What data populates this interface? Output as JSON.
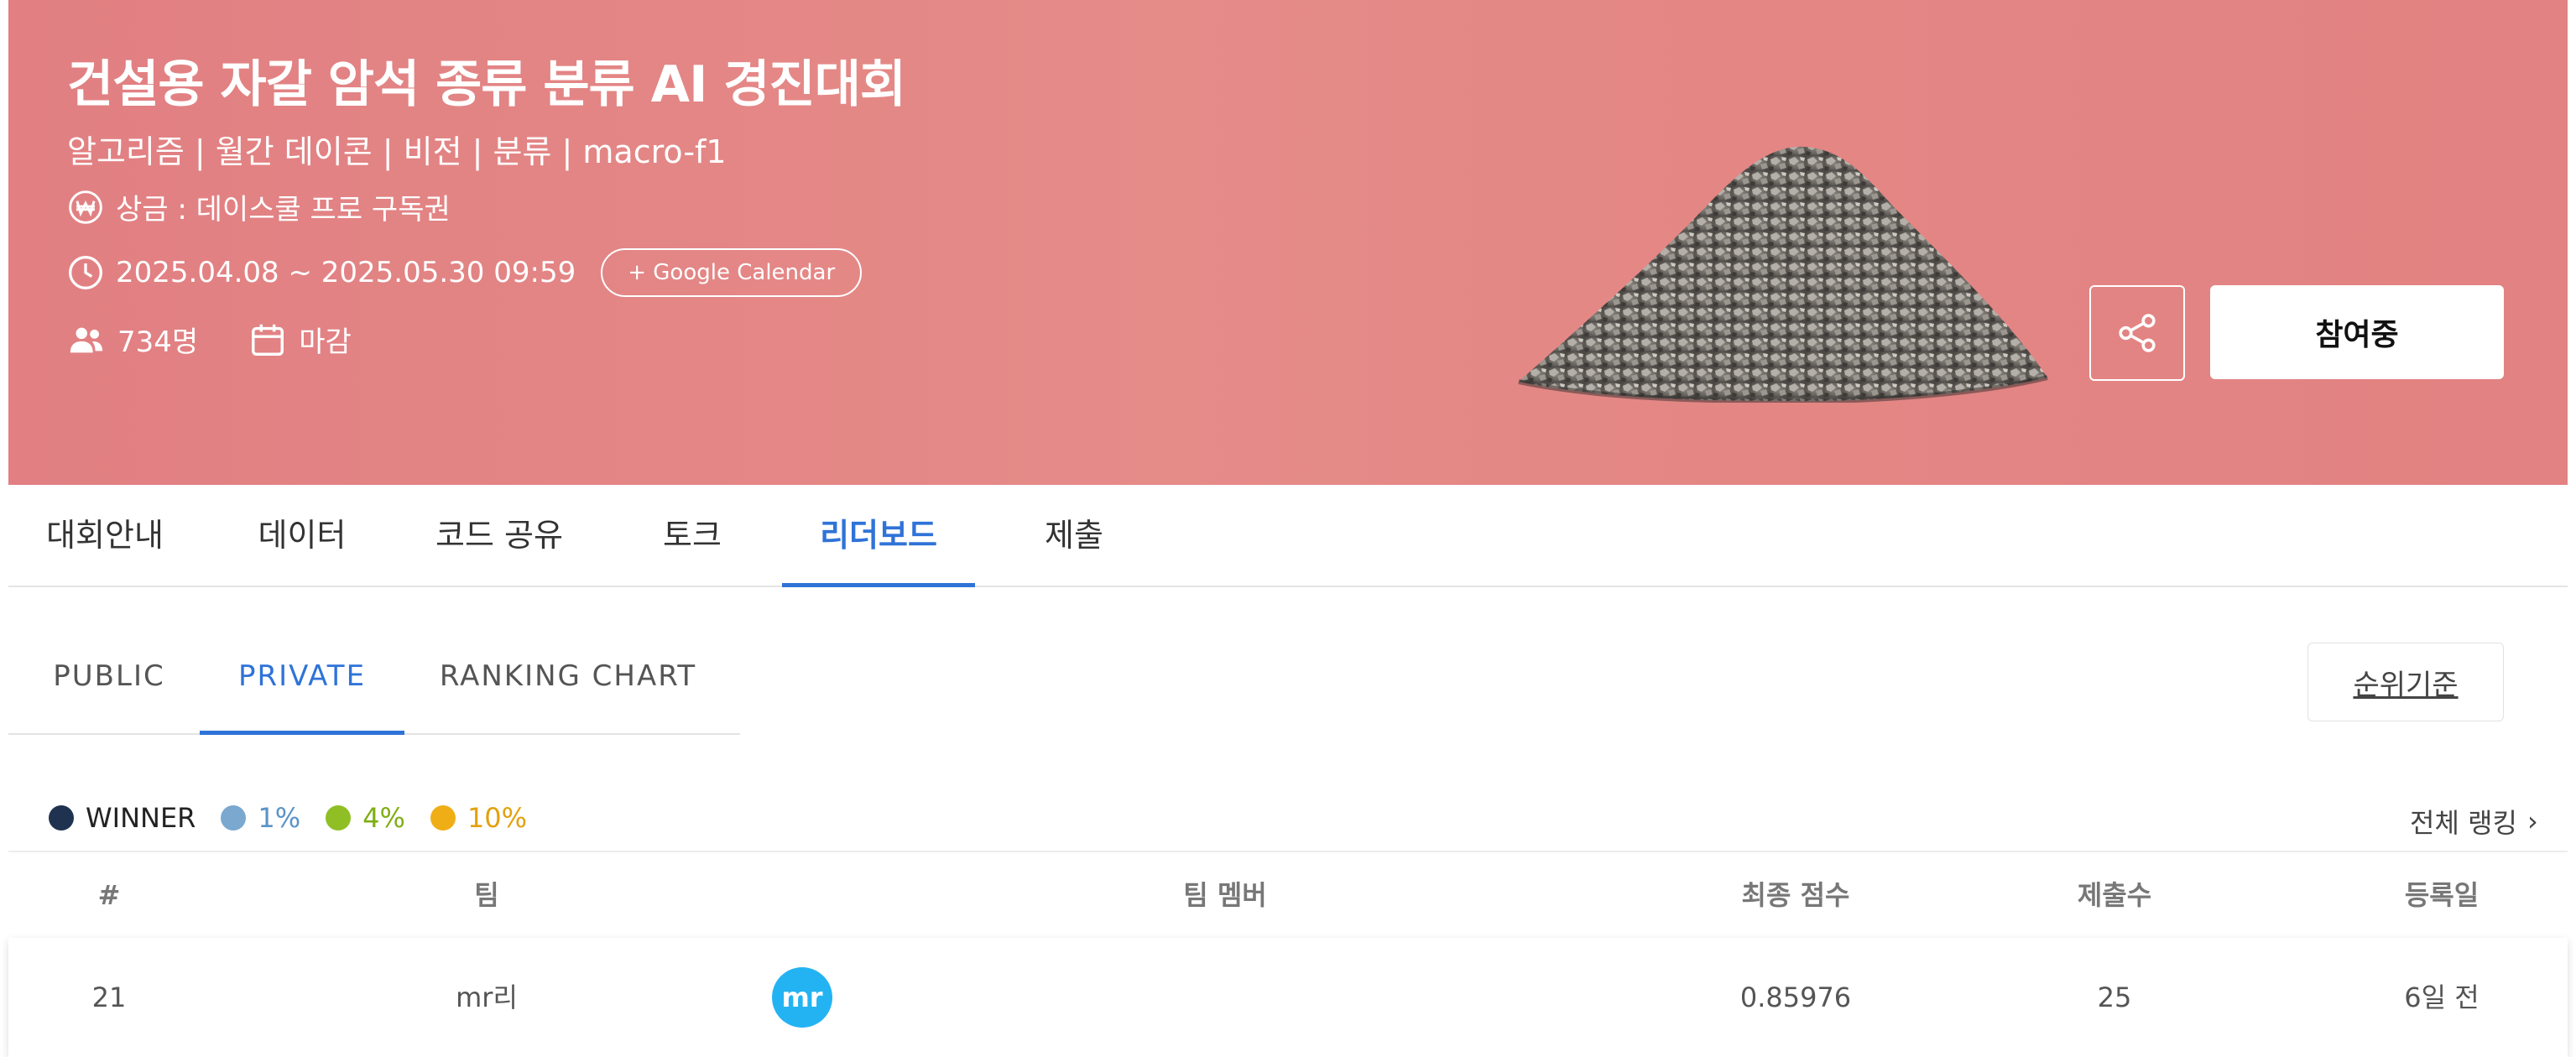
{
  "hero": {
    "title": "건설용 자갈 암석 종류 분류 AI 경진대회",
    "subtitle": "알고리즘 | 월간 데이콘 | 비전 | 분류 | macro-f1",
    "prize": "상금 : 데이스쿨 프로 구독권",
    "period": "2025.04.08 ~ 2025.05.30 09:59",
    "calendar_button": "+ Google Calendar",
    "participants": "734명",
    "status": "마감",
    "join_button": "참여중",
    "bg_color": "#e28585"
  },
  "tabs": [
    "대회안내",
    "데이터",
    "코드 공유",
    "토크",
    "리더보드",
    "제출"
  ],
  "active_tab": "리더보드",
  "subtabs": [
    "PUBLIC",
    "PRIVATE",
    "RANKING CHART"
  ],
  "active_subtab": "PRIVATE",
  "rank_criteria_button": "순위기준",
  "legend": [
    {
      "label": "WINNER",
      "color": "#1f3350",
      "text_color": "#222222"
    },
    {
      "label": "1%",
      "color": "#7aa8cf",
      "text_color": "#5b93c6"
    },
    {
      "label": "4%",
      "color": "#8fbf25",
      "text_color": "#7fae14"
    },
    {
      "label": "10%",
      "color": "#efae15",
      "text_color": "#e3a10d"
    }
  ],
  "all_ranking_link": "전체 랭킹",
  "table": {
    "headers": [
      "#",
      "팀",
      "팀 멤버",
      "최종 점수",
      "제출수",
      "등록일"
    ],
    "rows": [
      {
        "rank": "21",
        "team": "mr리",
        "member_avatar": "mr",
        "score": "0.85976",
        "submissions": "25",
        "registered": "6일 전"
      }
    ]
  }
}
